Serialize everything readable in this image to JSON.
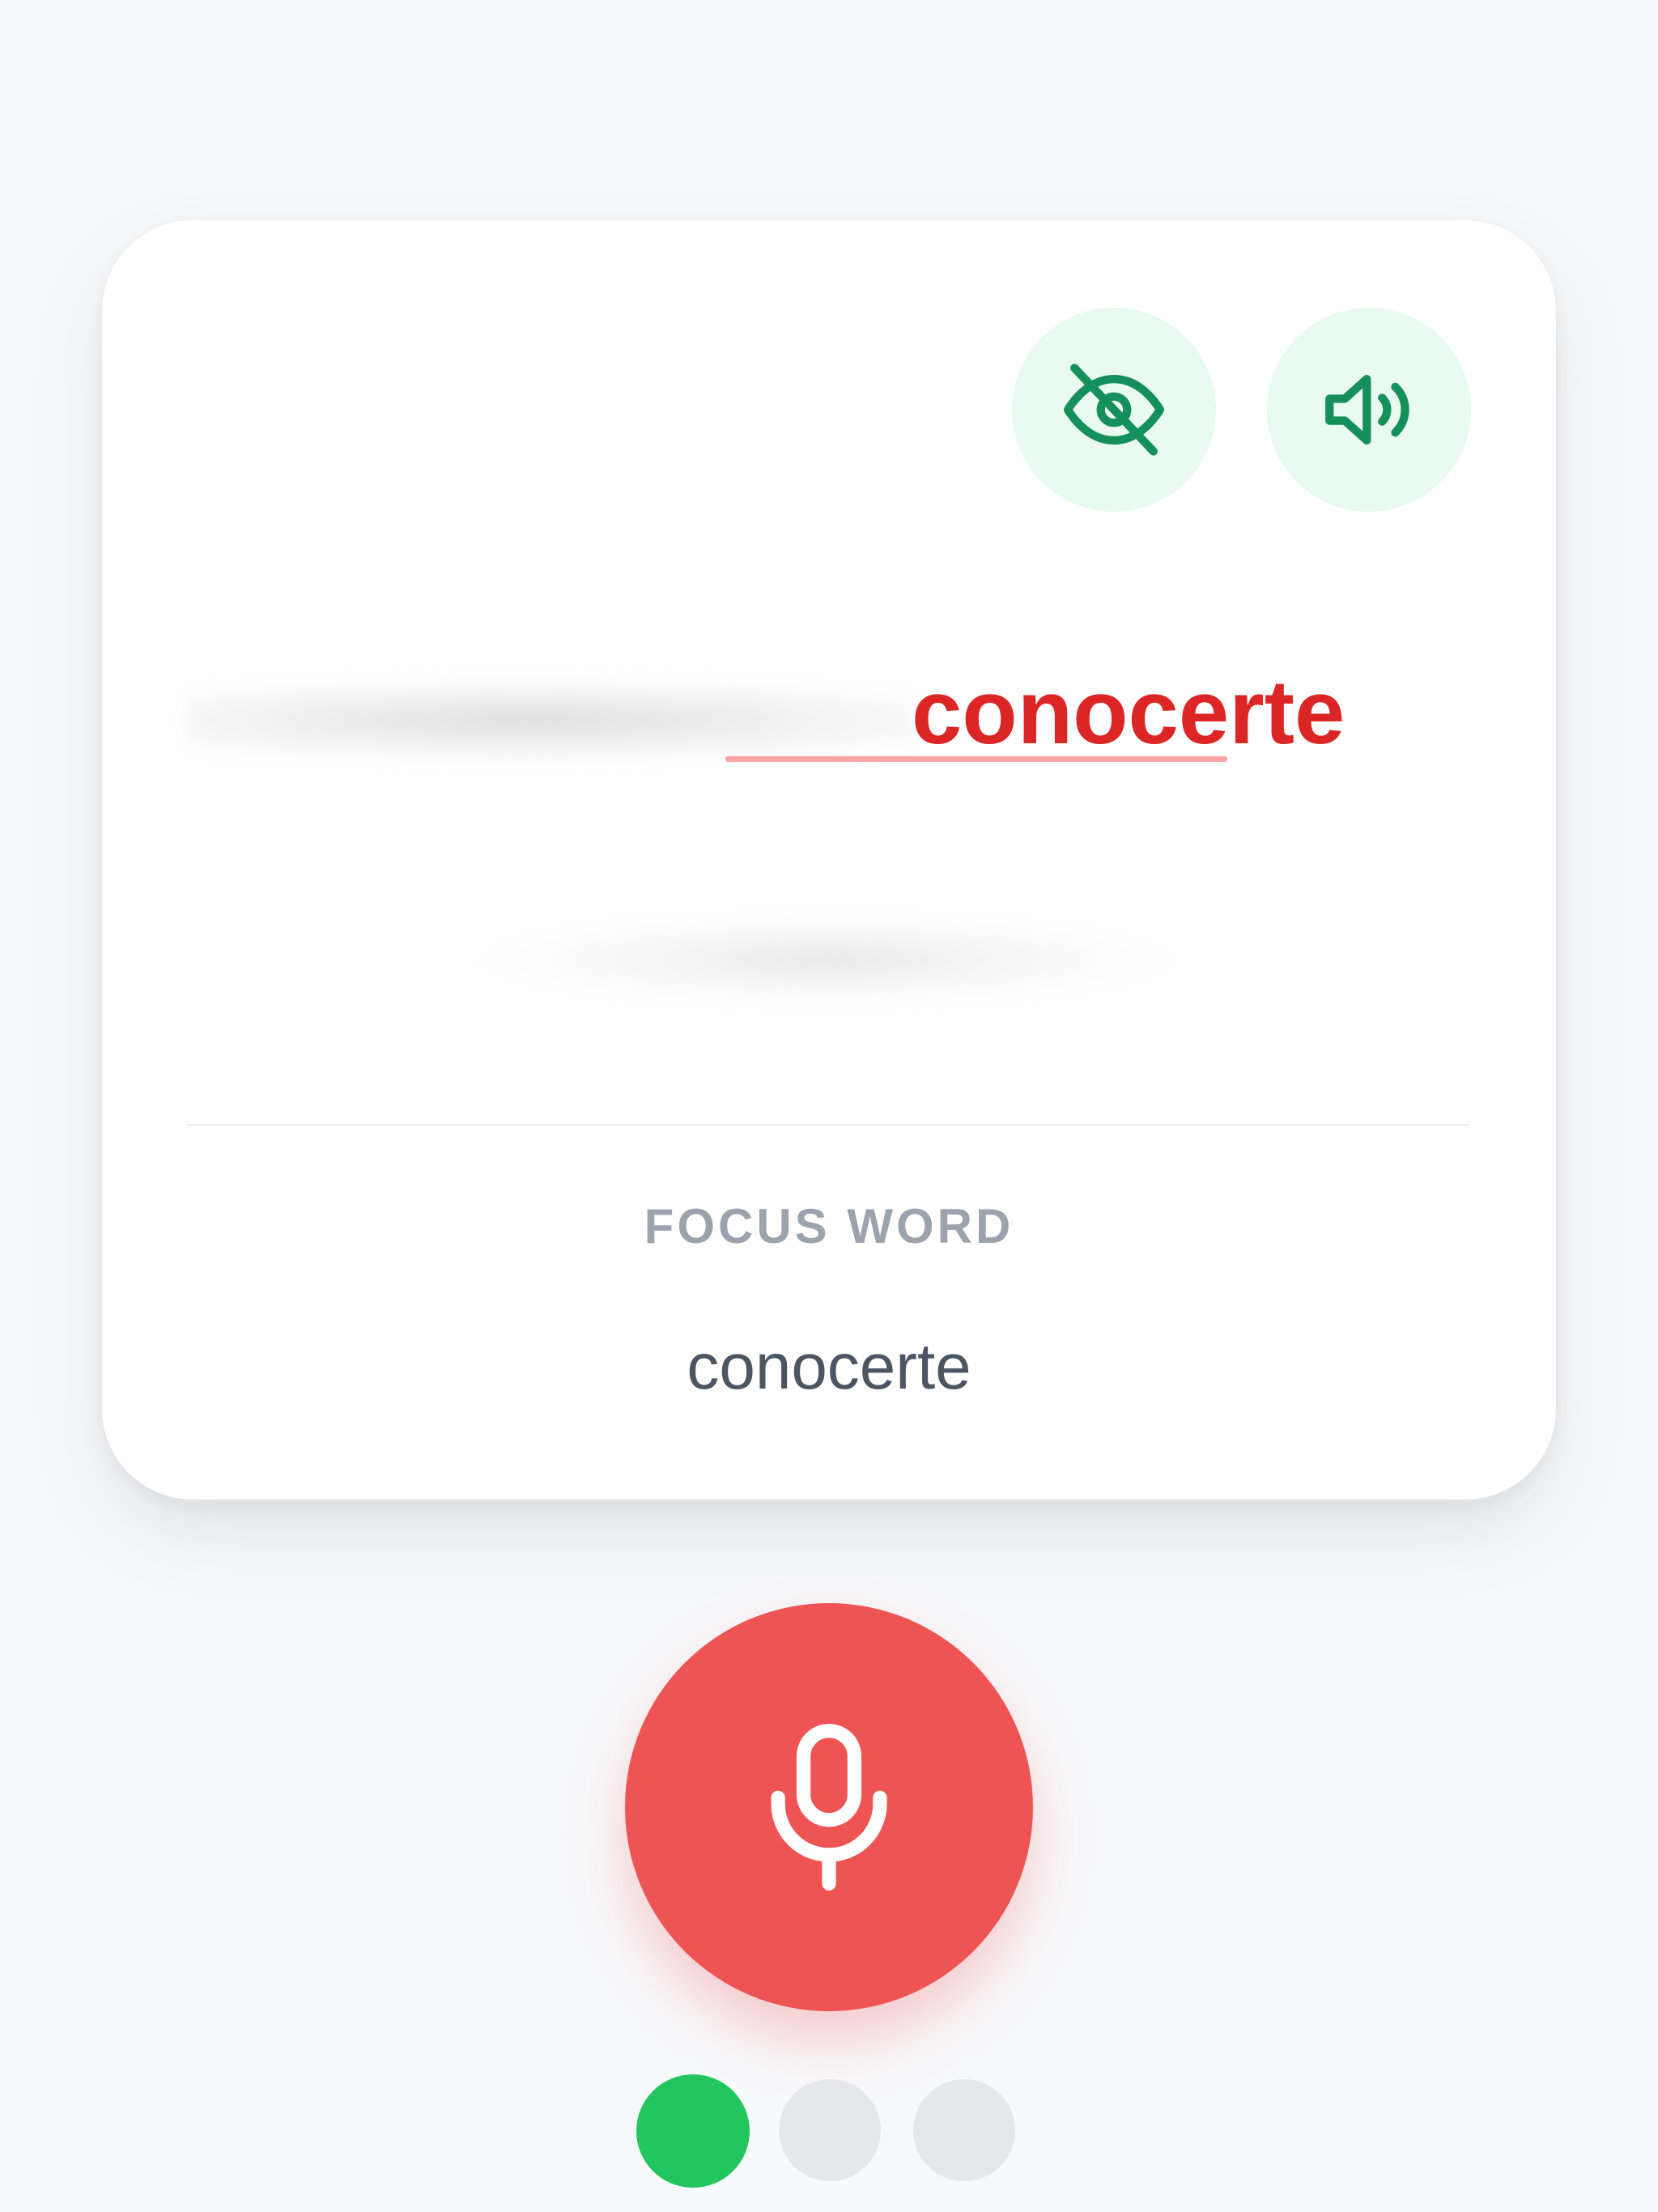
{
  "card": {
    "sentence": {
      "hidden_text": "",
      "focus_word": "conocerte"
    },
    "translation": {
      "hidden_text": ""
    },
    "focus_label": "FOCUS WORD",
    "focus_word": "conocerte"
  },
  "icons": {
    "hide_text": "eye-off-icon",
    "play_audio": "speaker-volume-icon",
    "record": "microphone-icon"
  },
  "progress": {
    "total_steps": 3,
    "current_step": 1
  },
  "colors": {
    "accent_green": "#22c55e",
    "icon_green": "#15905a",
    "focus_red": "#dc2626",
    "mic_red": "#ef5454",
    "inactive_dot": "#e5e7eb"
  }
}
